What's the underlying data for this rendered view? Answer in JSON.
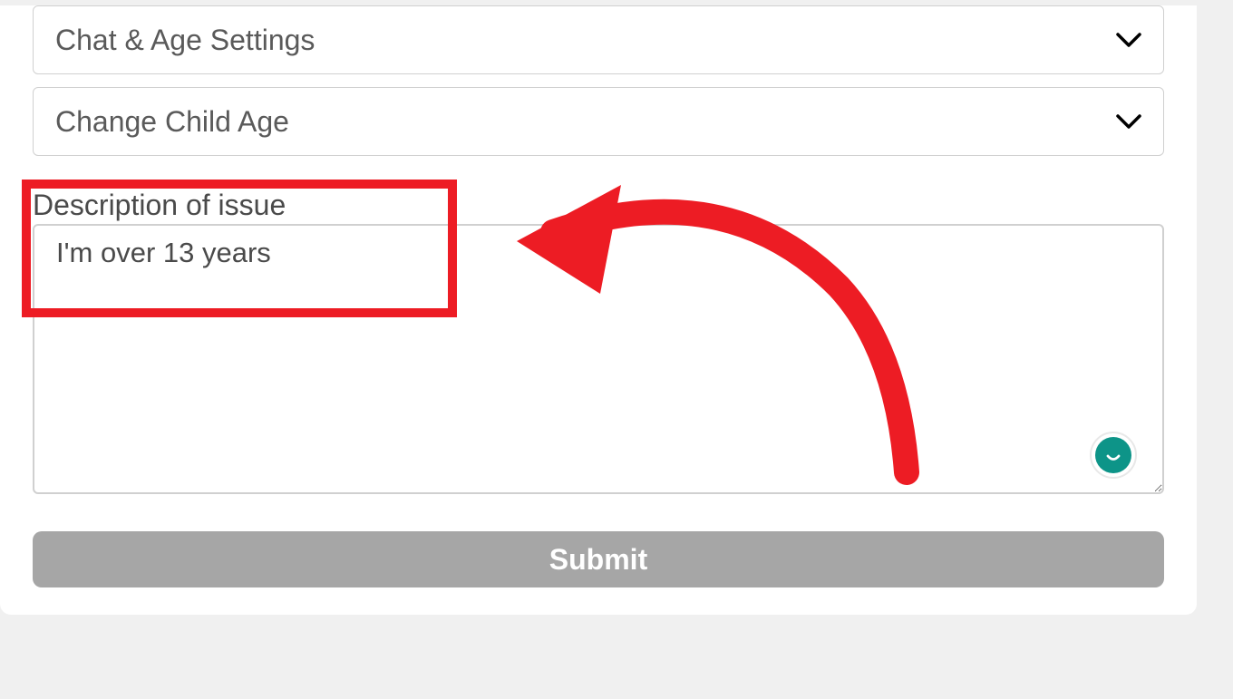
{
  "dropdowns": [
    {
      "label": "Chat & Age Settings"
    },
    {
      "label": "Change Child Age"
    }
  ],
  "description": {
    "label": "Description of issue",
    "value": "I'm over 13 years"
  },
  "submit": {
    "label": "Submit"
  },
  "annotation": {
    "color": "#ed1c24"
  }
}
